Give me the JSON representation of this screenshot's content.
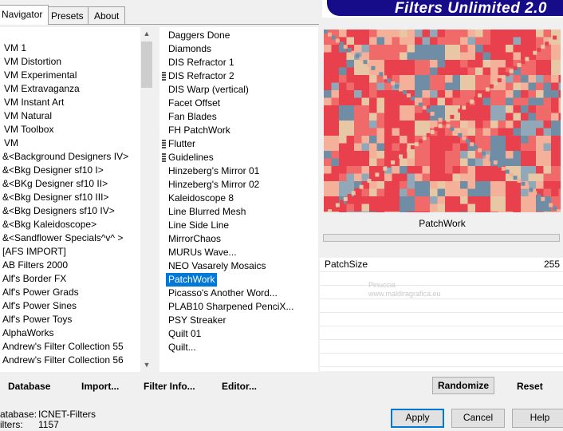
{
  "tabs": [
    {
      "label": "Navigator",
      "active": true
    },
    {
      "label": "Presets",
      "active": false
    },
    {
      "label": "About",
      "active": false
    }
  ],
  "app_title": "Filters Unlimited 2.0",
  "categories": [
    "VM 1",
    "VM Distortion",
    "VM Experimental",
    "VM Extravaganza",
    "VM Instant Art",
    "VM Natural",
    "VM Toolbox",
    "VM",
    "&<Background Designers IV>",
    "&<Bkg Designer sf10 I>",
    "&<BKg Designer sf10 II>",
    "&<Bkg Designer sf10 III>",
    "&<Bkg Designers sf10 IV>",
    "&<Bkg Kaleidoscope>",
    "&<Sandflower Specials^v^ >",
    "[AFS IMPORT]",
    "AB Filters 2000",
    "Alf's Border FX",
    "Alf's Power Grads",
    "Alf's Power Sines",
    "Alf's Power Toys",
    "AlphaWorks",
    "Andrew's Filter Collection 55",
    "Andrew's Filter Collection 56"
  ],
  "filters": [
    {
      "label": "Daggers Done",
      "group": false
    },
    {
      "label": "Diamonds",
      "group": false
    },
    {
      "label": "DIS Refractor 1",
      "group": false
    },
    {
      "label": "DIS Refractor 2",
      "group": true
    },
    {
      "label": "DIS Warp (vertical)",
      "group": false
    },
    {
      "label": "Facet Offset",
      "group": false
    },
    {
      "label": "Fan Blades",
      "group": false
    },
    {
      "label": "FH PatchWork",
      "group": false
    },
    {
      "label": "Flutter",
      "group": true
    },
    {
      "label": "Guidelines",
      "group": true
    },
    {
      "label": "Hinzeberg's Mirror 01",
      "group": false
    },
    {
      "label": "Hinzeberg's Mirror 02",
      "group": false
    },
    {
      "label": "Kaleidoscope 8",
      "group": false
    },
    {
      "label": "Line Blurred Mesh",
      "group": false
    },
    {
      "label": "Line Side Line",
      "group": false
    },
    {
      "label": "MirrorChaos",
      "group": false
    },
    {
      "label": "MURUs Wave...",
      "group": false
    },
    {
      "label": "NEO Vasarely Mosaics",
      "group": false
    },
    {
      "label": "PatchWork",
      "group": false,
      "selected": true
    },
    {
      "label": "Picasso's Another Word...",
      "group": false
    },
    {
      "label": "PLAB10 Sharpened PenciX...",
      "group": false
    },
    {
      "label": "PSY Streaker",
      "group": false
    },
    {
      "label": "Quilt 01",
      "group": false
    },
    {
      "label": "Quilt...",
      "group": false
    }
  ],
  "preview": {
    "label": "PatchWork",
    "colors": [
      "#e8404c",
      "#f06a6a",
      "#f5b09a",
      "#e8c8a4",
      "#6f8ea6",
      "#90a8b8"
    ]
  },
  "params": [
    {
      "name": "PatchSize",
      "value": "255"
    }
  ],
  "watermark": {
    "line1": "Pinuccia",
    "line2": "www.maldiragrafica.eu"
  },
  "toolbar": {
    "database": "Database",
    "import": "Import...",
    "filter_info": "Filter Info...",
    "editor": "Editor...",
    "randomize": "Randomize",
    "reset": "Reset"
  },
  "status": {
    "database_label": "atabase:",
    "database_value": "ICNET-Filters",
    "filters_label": "ilters:",
    "filters_value": "1157"
  },
  "dialog": {
    "apply": "Apply",
    "cancel": "Cancel",
    "help": "Help"
  }
}
